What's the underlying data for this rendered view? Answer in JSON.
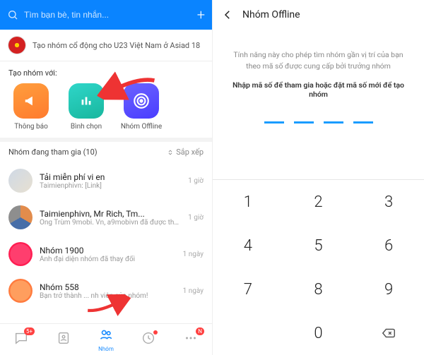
{
  "search": {
    "placeholder": "Tìm bạn bè, tin nhắn..."
  },
  "banner": {
    "text": "Tạo nhóm cổ động cho U23 Việt Nam ở Asiad 18"
  },
  "create_section": {
    "title": "Tạo nhóm với:",
    "tiles": {
      "announce": "Thông báo",
      "poll": "Bình chọn",
      "offline": "Nhóm Offline"
    }
  },
  "groups_section": {
    "header": "Nhóm đang tham gia (10)",
    "sort_label": "Sắp xếp"
  },
  "groups": [
    {
      "title": "Tải miễn phí vi en",
      "subtitle": "Taimienphivn: [Link]",
      "time": "1 giờ",
      "avatar_bg": "linear-gradient(135deg,#cfd9e6,#e7e0d1)"
    },
    {
      "title": "Taimienphivn, Mr Rich, Tm...",
      "subtitle": "Ông Trùm 9mobi. Vn, a9mobivn đã được thêm v...",
      "time": "1 giờ",
      "avatar_bg": "conic-gradient(#e28c4c 0 120deg,#476ea8 120deg 240deg,#8e8e8e 240deg)"
    },
    {
      "title": "Nhóm 1900",
      "subtitle": "Ảnh đại diện nhóm đã thay đổi",
      "time": "1 ngày",
      "avatar_bg": "radial-gradient(circle,#ff3e6e 0 60%, #ff1e52 61%)"
    },
    {
      "title": "Nhóm 558",
      "subtitle": "Bạn trở thành ... nh viên của nhóm!",
      "time": "1 ngày",
      "avatar_bg": "radial-gradient(circle,#ff9e5e 0 60%, #ff7b3e 61%)"
    }
  ],
  "bottom_nav": {
    "chat_badge": "5+",
    "active_label": "Nhóm"
  },
  "right": {
    "title": "Nhóm Offline",
    "desc": "Tính năng này cho phép tìm nhóm gần vị trí của bạn theo mã số được cung cấp bởi trưởng nhóm",
    "desc2": "Nhập mã số để tham gia hoặc đặt mã số mới để tạo nhóm",
    "keys": [
      "1",
      "2",
      "3",
      "4",
      "5",
      "6",
      "7",
      "8",
      "9",
      "",
      "0",
      "⌫"
    ]
  }
}
